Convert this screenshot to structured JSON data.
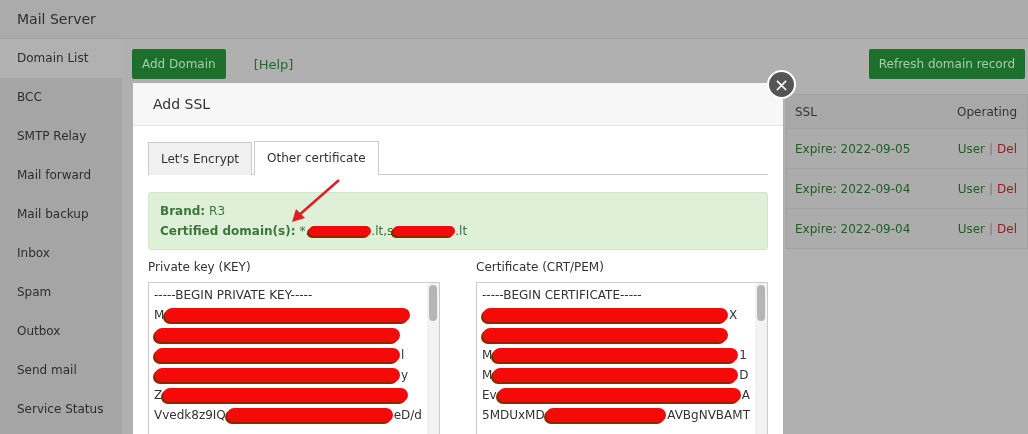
{
  "app_title": "Mail Server",
  "sidebar": {
    "items": [
      {
        "label": "Domain List",
        "selected": true
      },
      {
        "label": "BCC",
        "selected": false
      },
      {
        "label": "SMTP Relay",
        "selected": false
      },
      {
        "label": "Mail forward",
        "selected": false
      },
      {
        "label": "Mail backup",
        "selected": false
      },
      {
        "label": "Inbox",
        "selected": false
      },
      {
        "label": "Spam",
        "selected": false
      },
      {
        "label": "Outbox",
        "selected": false
      },
      {
        "label": "Send mail",
        "selected": false
      },
      {
        "label": "Service Status",
        "selected": false
      }
    ]
  },
  "toolbar": {
    "add_button": "Add Domain",
    "help_link": "[Help]",
    "refresh_button": "Refresh domain record"
  },
  "table": {
    "columns": [
      "SSL",
      "Operating"
    ],
    "rows": [
      {
        "ssl": "Expire: 2022-09-05",
        "user": "User",
        "sep": "|",
        "del": "Del"
      },
      {
        "ssl": "Expire: 2022-09-04",
        "user": "User",
        "sep": "|",
        "del": "Del"
      },
      {
        "ssl": "Expire: 2022-09-04",
        "user": "User",
        "sep": "|",
        "del": "Del"
      }
    ]
  },
  "dialog": {
    "title": "Add SSL",
    "close": "×",
    "tabs": [
      {
        "label": "Let's Encrypt",
        "selected": false
      },
      {
        "label": "Other certificate",
        "selected": true
      }
    ],
    "info": {
      "brand_label": "Brand:",
      "brand": "R3",
      "domains_label": "Certified domain(s):",
      "domain_parts": [
        {
          "kind": "text",
          "text": "*."
        },
        {
          "kind": "redacted"
        },
        {
          "kind": "text",
          "text": ".lt,s"
        },
        {
          "kind": "redacted"
        },
        {
          "kind": "text",
          "text": ".lt"
        }
      ]
    },
    "key": {
      "label": "Private key (KEY)",
      "lines": [
        {
          "lead": "-----BEGIN PRIVATE KEY-----"
        },
        {
          "lead": "M",
          "redacted": true
        },
        {
          "redacted": true
        },
        {
          "redacted": true,
          "tail": "l"
        },
        {
          "redacted": true,
          "tail": "y"
        },
        {
          "lead": "Z",
          "redacted": true
        },
        {
          "lead": "Vvedk8z9IQ",
          "redacted": true,
          "tail": "eD/d"
        }
      ]
    },
    "cert": {
      "label": "Certificate (CRT/PEM)",
      "lines": [
        {
          "lead": "-----BEGIN CERTIFICATE-----"
        },
        {
          "redacted": true,
          "tail": "X"
        },
        {
          "redacted": true
        },
        {
          "lead": "M",
          "redacted": true,
          "tail": "1"
        },
        {
          "lead": "M",
          "redacted": true,
          "tail": "D"
        },
        {
          "lead": "Ev",
          "redacted": true,
          "tail": "A"
        },
        {
          "lead": "5MDUxMD",
          "redacted": true,
          "tail": "AVBgNVBAMT"
        }
      ]
    }
  }
}
